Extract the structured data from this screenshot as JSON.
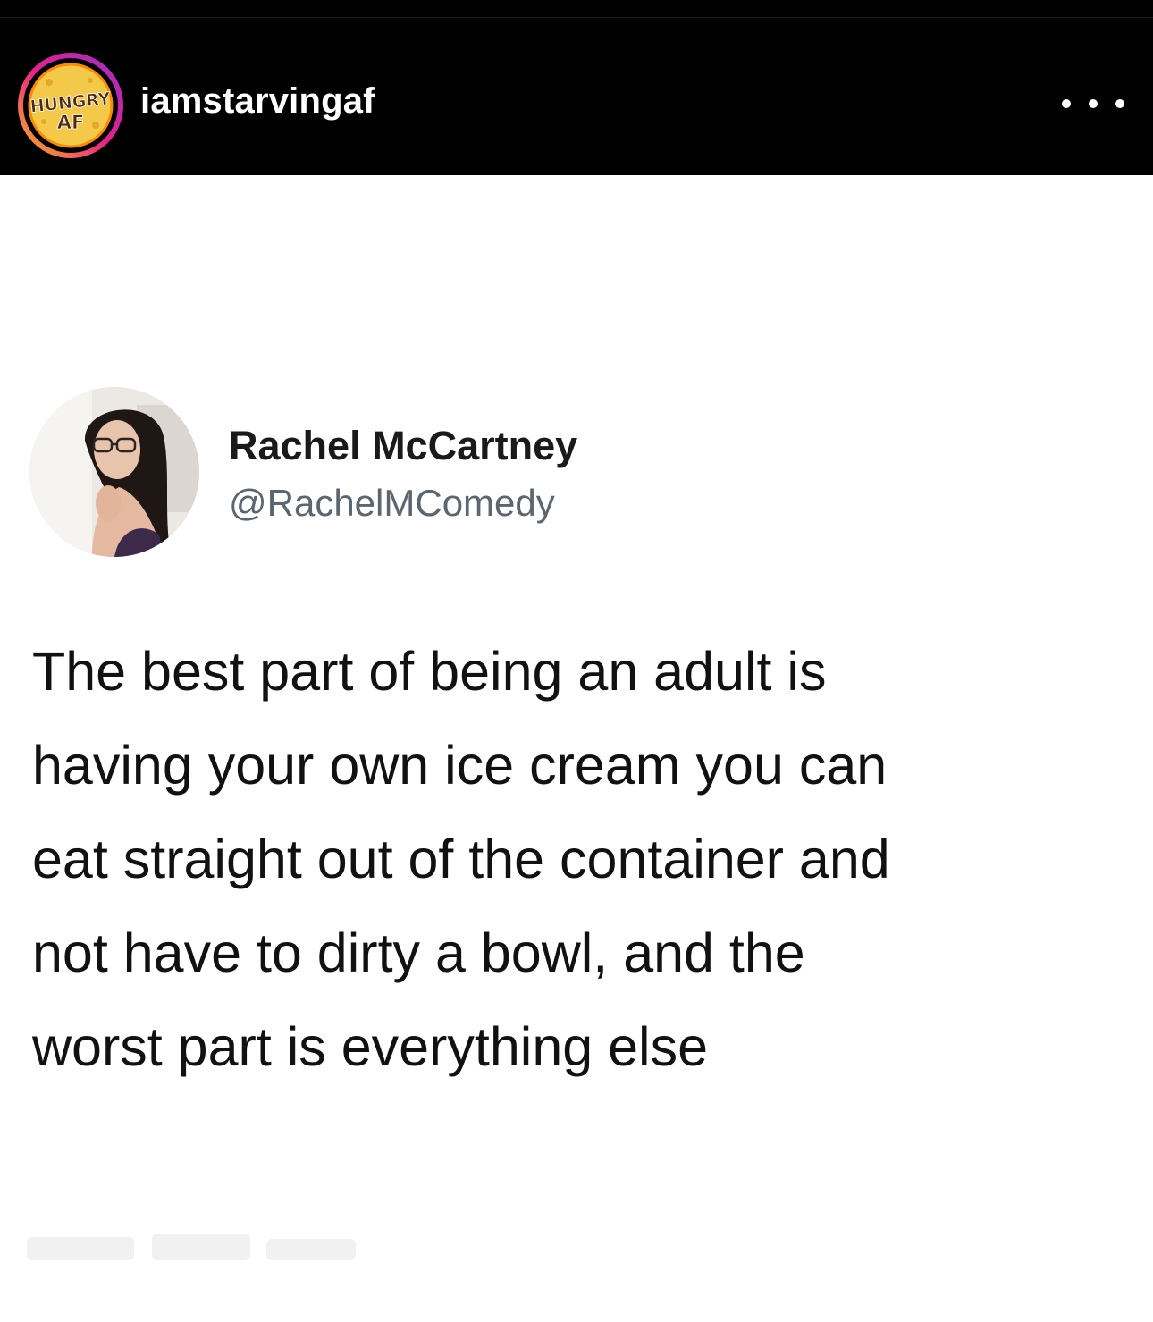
{
  "post": {
    "account": {
      "username": "iamstarvingaf",
      "avatar_icon": "hungry-af-logo-icon",
      "avatar_logo_text": [
        "HUNGRY",
        "AF"
      ],
      "ring_colors": [
        "#f7b51b",
        "#e91e8c",
        "#9b2fc9"
      ]
    },
    "more_icon": "ellipsis-icon"
  },
  "tweet": {
    "display_name": "Rachel McCartney",
    "handle": "@RachelMComedy",
    "avatar_icon": "profile-photo-icon",
    "text_lines": [
      "The best part of being an adult is",
      "having your own ice cream you can",
      "eat straight out of the container and",
      "not have to dirty a bowl, and the",
      "worst part is everything else"
    ]
  },
  "colors": {
    "header_bg": "#000000",
    "post_bg": "#ffffff",
    "tweet_text": "#111111",
    "handle_text": "#5b6670"
  }
}
